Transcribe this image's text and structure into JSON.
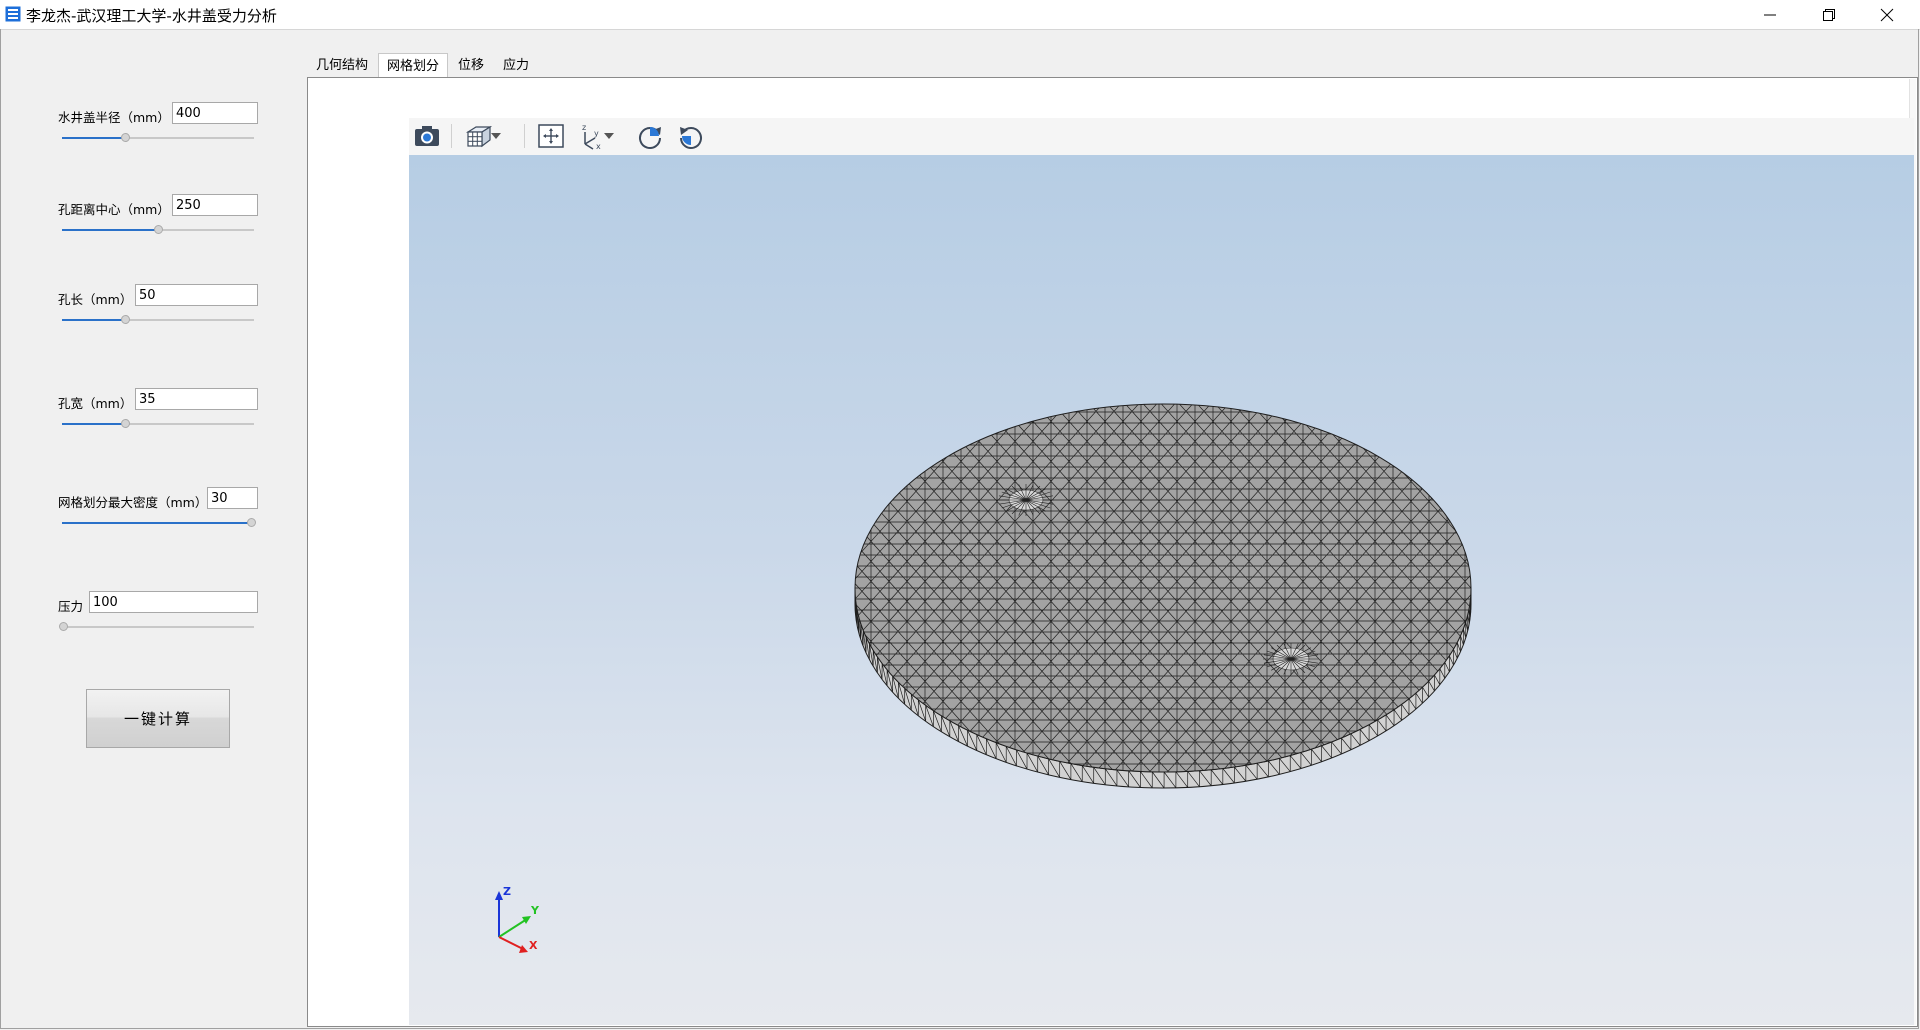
{
  "window": {
    "title": "李龙杰-武汉理工大学-水井盖受力分析",
    "icons": [
      "app-icon",
      "minimize-icon",
      "restore-icon",
      "close-icon"
    ]
  },
  "params": [
    {
      "label": "水井盖半径（mm）",
      "value": "400",
      "slider_fraction": 0.33
    },
    {
      "label": "孔距离中心（mm）",
      "value": "250",
      "slider_fraction": 0.5
    },
    {
      "label": "孔长（mm）",
      "value": "50",
      "slider_fraction": 0.33
    },
    {
      "label": "孔宽（mm）",
      "value": "35",
      "slider_fraction": 0.33
    },
    {
      "label": "网格划分最大密度（mm）",
      "value": "30",
      "slider_fraction": 1.0
    },
    {
      "label": "压力",
      "value": "100",
      "slider_fraction": 0.0
    }
  ],
  "calc_button": "一键计算",
  "tabs": [
    {
      "label": "几何结构",
      "active": false
    },
    {
      "label": "网格划分",
      "active": true
    },
    {
      "label": "位移",
      "active": false
    },
    {
      "label": "应力",
      "active": false
    }
  ],
  "toolbar": {
    "icons": [
      "camera-icon",
      "view-cube-icon",
      "dropdown-arrow-icon",
      "fit-view-icon",
      "axes-icon",
      "dropdown-arrow-icon",
      "rotate-cw-icon",
      "rotate-ccw-icon"
    ]
  },
  "viewport": {
    "model": "manhole cover tetrahedral mesh",
    "colors": {
      "mesh_fill": "#a3a3a3",
      "mesh_edge": "#1e1e1e",
      "side_fill": "#d2d2d2",
      "bg_top": "#b6cde4",
      "bg_bottom": "#e6e9ee"
    },
    "triad": {
      "z": "Z",
      "y": "Y",
      "x": "X",
      "colors": {
        "z": "#1a35d8",
        "y": "#22c222",
        "x": "#e02020"
      }
    }
  }
}
